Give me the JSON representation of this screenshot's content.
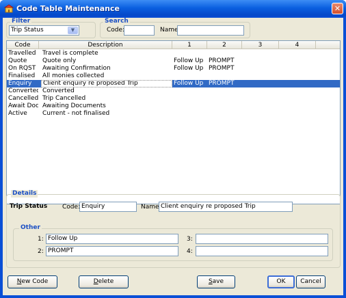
{
  "window": {
    "title": "Code Table Maintenance",
    "close_glyph": "✕"
  },
  "filter": {
    "group_label": "Filter",
    "selected": "Trip Status",
    "dropdown_glyph": "▼"
  },
  "search": {
    "group_label": "Search",
    "code_label": "Code:",
    "code_value": "",
    "name_label": "Name:",
    "name_value": ""
  },
  "grid": {
    "columns": [
      "Code",
      "Description",
      "1",
      "2",
      "3",
      "4"
    ],
    "rows": [
      {
        "code": "Travelled",
        "description": "Travel is complete",
        "c1": "",
        "c2": "",
        "c3": "",
        "c4": ""
      },
      {
        "code": "Quote",
        "description": "Quote only",
        "c1": "Follow Up",
        "c2": "PROMPT",
        "c3": "",
        "c4": ""
      },
      {
        "code": "On RQST",
        "description": "Awaiting Confirmation",
        "c1": "Follow Up",
        "c2": "PROMPT",
        "c3": "",
        "c4": ""
      },
      {
        "code": "Finalised",
        "description": "All monies collected",
        "c1": "",
        "c2": "",
        "c3": "",
        "c4": ""
      },
      {
        "code": "Enquiry",
        "description": "Client enquiry re proposed Trip",
        "c1": "Follow Up",
        "c2": "PROMPT",
        "c3": "",
        "c4": ""
      },
      {
        "code": "Converted",
        "description": "Converted",
        "c1": "",
        "c2": "",
        "c3": "",
        "c4": ""
      },
      {
        "code": "Cancelled",
        "description": "Trip Cancelled",
        "c1": "",
        "c2": "",
        "c3": "",
        "c4": ""
      },
      {
        "code": "Await Docs",
        "description": "Awaiting Documents",
        "c1": "",
        "c2": "",
        "c3": "",
        "c4": ""
      },
      {
        "code": "Active",
        "description": "Current - not finalised",
        "c1": "",
        "c2": "",
        "c3": "",
        "c4": ""
      }
    ],
    "selected_index": 4
  },
  "details": {
    "group_label": "Details",
    "section_title": "Trip Status",
    "code_label": "Code:",
    "code_value": "Enquiry",
    "name_label": "Name:",
    "name_value": "Client enquiry re proposed Trip"
  },
  "other": {
    "group_label": "Other",
    "f1_label": "1:",
    "f1_value": "Follow Up",
    "f2_label": "2:",
    "f2_value": "PROMPT",
    "f3_label": "3:",
    "f3_value": "",
    "f4_label": "4:",
    "f4_value": ""
  },
  "buttons": {
    "new_code_mnemonic": "N",
    "new_code_rest": "ew Code",
    "delete_mnemonic": "D",
    "delete_rest": "elete",
    "save_mnemonic": "S",
    "save_rest": "ave",
    "ok": "OK",
    "cancel": "Cancel"
  },
  "colors": {
    "accent": "#1b4fc4",
    "selection": "#316ac5",
    "titlebar": "#0a5fe0"
  }
}
